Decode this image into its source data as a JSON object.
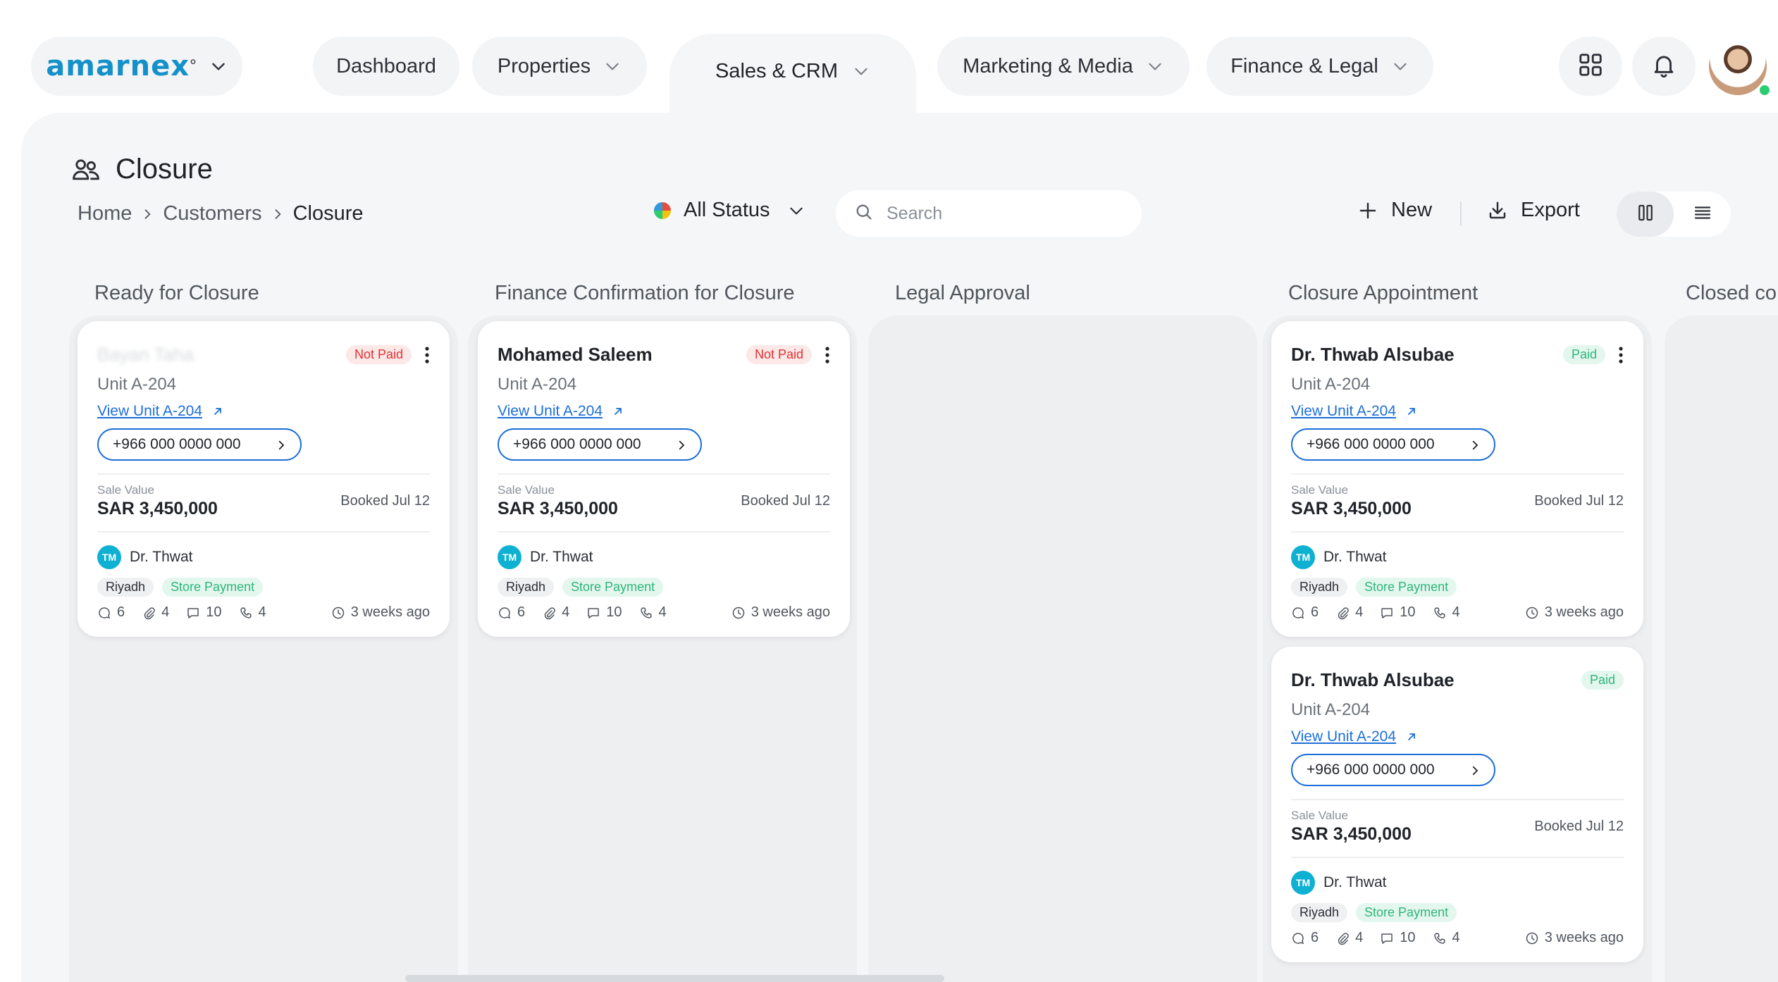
{
  "brand": {
    "logo_text": "amarnex"
  },
  "nav": {
    "dashboard": "Dashboard",
    "properties": "Properties",
    "sales_crm": "Sales & CRM",
    "marketing": "Marketing & Media",
    "finance": "Finance & Legal"
  },
  "page": {
    "title": "Closure",
    "breadcrumb": [
      "Home",
      "Customers",
      "Closure"
    ]
  },
  "toolbar": {
    "status_filter": "All Status",
    "search_placeholder": "Search",
    "new_label": "New",
    "export_label": "Export"
  },
  "columns": [
    {
      "title": "Ready for Closure"
    },
    {
      "title": "Finance Confirmation for Closure"
    },
    {
      "title": "Legal Approval"
    },
    {
      "title": "Closure Appointment"
    },
    {
      "title": "Closed co"
    }
  ],
  "cards": [
    {
      "name": "Bayan Taha",
      "status": "Not Paid",
      "unit": "Unit A-204",
      "link": "View Unit A-204",
      "phone": "+966 000 0000 000",
      "sale_label": "Sale Value",
      "sale_value": "SAR 3,450,000",
      "booked": "Booked Jul 12",
      "agent_initials": "TM",
      "agent": "Dr. Thwat",
      "tags": [
        "Riyadh",
        "Store Payment"
      ],
      "comments": "6",
      "attachments": "4",
      "messages": "10",
      "calls": "4",
      "ago": "3 weeks ago"
    },
    {
      "name": "Mohamed Saleem",
      "status": "Not Paid",
      "unit": "Unit A-204",
      "link": "View Unit A-204",
      "phone": "+966 000 0000 000",
      "sale_label": "Sale Value",
      "sale_value": "SAR 3,450,000",
      "booked": "Booked Jul 12",
      "agent_initials": "TM",
      "agent": "Dr. Thwat",
      "tags": [
        "Riyadh",
        "Store Payment"
      ],
      "comments": "6",
      "attachments": "4",
      "messages": "10",
      "calls": "4",
      "ago": "3 weeks ago"
    },
    {
      "name": "Dr. Thwab Alsubae",
      "status": "Paid",
      "unit": "Unit A-204",
      "link": "View Unit A-204",
      "phone": "+966 000 0000 000",
      "sale_label": "Sale Value",
      "sale_value": "SAR 3,450,000",
      "booked": "Booked Jul 12",
      "agent_initials": "TM",
      "agent": "Dr. Thwat",
      "tags": [
        "Riyadh",
        "Store Payment"
      ],
      "comments": "6",
      "attachments": "4",
      "messages": "10",
      "calls": "4",
      "ago": "3 weeks ago"
    },
    {
      "name": "Dr. Thwab Alsubae",
      "status": "Paid",
      "unit": "Unit A-204",
      "link": "View Unit A-204",
      "phone": "+966 000 0000 000",
      "sale_label": "Sale Value",
      "sale_value": "SAR 3,450,000",
      "booked": "Booked Jul 12",
      "agent_initials": "TM",
      "agent": "Dr. Thwat",
      "tags": [
        "Riyadh",
        "Store Payment"
      ],
      "comments": "6",
      "attachments": "4",
      "messages": "10",
      "calls": "4",
      "ago": "3 weeks ago"
    }
  ],
  "colors": {
    "brand": "#1591c9",
    "link": "#1d6fd8",
    "not_paid_text": "#e03131",
    "paid_text": "#2fb57a",
    "agent_avatar": "#0fb1d3"
  }
}
